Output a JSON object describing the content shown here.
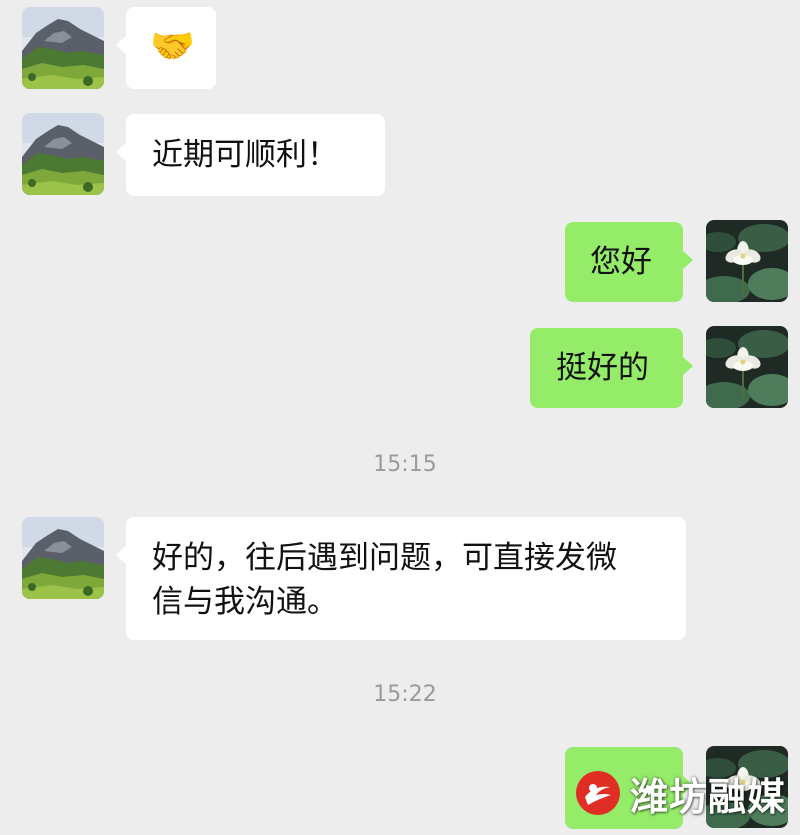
{
  "colors": {
    "background": "#ededed",
    "incoming_bubble": "#ffffff",
    "outgoing_bubble": "#95ec69",
    "timestamp_text": "#9a9a9a",
    "watermark_logo": "#e02e24"
  },
  "chat": {
    "messages": [
      {
        "sender": "contact",
        "emoji": "🤝"
      },
      {
        "sender": "contact",
        "text": "近期可顺利！"
      },
      {
        "sender": "me",
        "text": "您好"
      },
      {
        "sender": "me",
        "text": "挺好的"
      },
      {
        "sender": "contact",
        "text": "好的，往后遇到问题，可直接发微\n信与我沟通。"
      },
      {
        "sender": "me",
        "text": ""
      }
    ],
    "timestamps": [
      "15:15",
      "15:22"
    ]
  },
  "avatars": {
    "contact": {
      "icon": "mountain-landscape"
    },
    "me": {
      "icon": "white-lotus-flower"
    }
  },
  "watermark": {
    "text": "潍坊融媒"
  }
}
